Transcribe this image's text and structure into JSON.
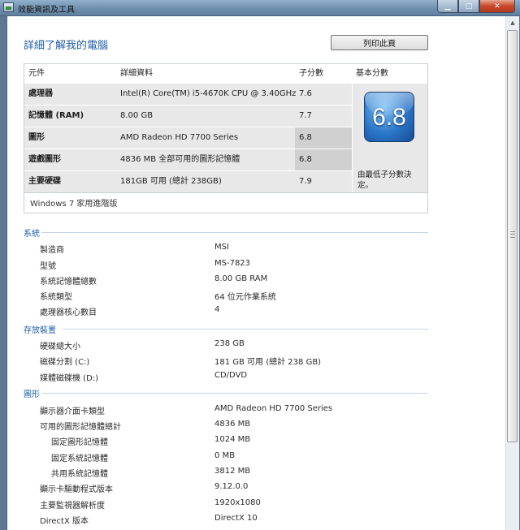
{
  "window": {
    "title": "效能資訊及工具",
    "min_glyph": "▁",
    "max_glyph": "□",
    "close_glyph": "✕"
  },
  "header": {
    "title": "詳細了解我的電腦",
    "print_label": "列印此頁"
  },
  "rating": {
    "columns": {
      "component": "元件",
      "detail": "詳細資料",
      "subscore": "子分數",
      "base": "基本分數"
    },
    "rows": [
      {
        "component": "處理器",
        "detail": "Intel(R) Core(TM) i5-4670K CPU @ 3.40GHz",
        "score": "7.6"
      },
      {
        "component": "記憶體 (RAM)",
        "detail": "8.00 GB",
        "score": "7.7"
      },
      {
        "component": "圖形",
        "detail": "AMD Radeon HD 7700 Series",
        "score": "6.8"
      },
      {
        "component": "遊戲圖形",
        "detail": "4836 MB 全部可用的圖形記憶體",
        "score": "6.8"
      },
      {
        "component": "主要硬碟",
        "detail": "181GB 可用 (總計 238GB)",
        "score": "7.9"
      }
    ],
    "base_score": "6.8",
    "base_note": "由最低子分數決定。",
    "edition": "Windows 7 家用進階版"
  },
  "sections": {
    "system": {
      "title": "系統",
      "items": [
        {
          "label": "製造商",
          "value": "MSI"
        },
        {
          "label": "型號",
          "value": "MS-7823"
        },
        {
          "label": "系統記憶體總數",
          "value": "8.00 GB RAM"
        },
        {
          "label": "系統類型",
          "value": "64 位元作業系統"
        },
        {
          "label": "處理器核心數目",
          "value": "4"
        }
      ]
    },
    "storage": {
      "title": "存放裝置",
      "items": [
        {
          "label": "硬碟總大小",
          "value": "238 GB"
        },
        {
          "label": "磁碟分割 (C:)",
          "value": "181 GB 可用 (總計 238 GB)"
        },
        {
          "label": "媒體磁碟機 (D:)",
          "value": "CD/DVD"
        }
      ]
    },
    "graphics": {
      "title": "圖形",
      "items": [
        {
          "label": "顯示器介面卡類型",
          "value": "AMD Radeon HD 7700 Series"
        },
        {
          "label": "可用的圖形記憶體總計",
          "value": "4836 MB"
        },
        {
          "label": "固定圖形記憶體",
          "value": "1024 MB"
        },
        {
          "label": "固定系統記憶體",
          "value": "0 MB"
        },
        {
          "label": "共用系統記憶體",
          "value": "3812 MB"
        },
        {
          "label": "顯示卡驅動程式版本",
          "value": "9.12.0.0"
        },
        {
          "label": "主要監視器解析度",
          "value": "1920x1080"
        },
        {
          "label": "DirectX 版本",
          "value": "DirectX 10"
        }
      ]
    }
  }
}
